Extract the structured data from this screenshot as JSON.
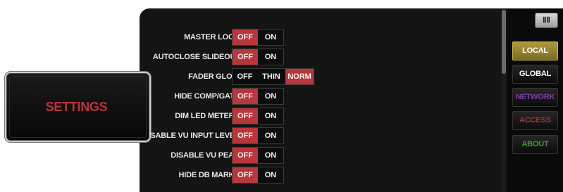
{
  "settings_tab": {
    "title": "SETTINGS"
  },
  "rows": [
    {
      "label": "MASTER LOCK:",
      "options": [
        "OFF",
        "ON"
      ],
      "selected": "OFF"
    },
    {
      "label": "AUTOCLOSE SLIDEOUT:",
      "options": [
        "OFF",
        "ON"
      ],
      "selected": "OFF"
    },
    {
      "label": "FADER GLOW:",
      "options": [
        "OFF",
        "THIN",
        "NORM"
      ],
      "selected": "NORM"
    },
    {
      "label": "HIDE COMP/GATE:",
      "options": [
        "OFF",
        "ON"
      ],
      "selected": "OFF"
    },
    {
      "label": "DIM LED METERS:",
      "options": [
        "OFF",
        "ON"
      ],
      "selected": "OFF"
    },
    {
      "label": "SABLE VU INPUT LEVEL:",
      "options": [
        "OFF",
        "ON"
      ],
      "selected": "OFF"
    },
    {
      "label": "DISABLE VU PEAK:",
      "options": [
        "OFF",
        "ON"
      ],
      "selected": "OFF"
    },
    {
      "label": "HIDE DB MARKS:",
      "options": [
        "OFF",
        "ON"
      ],
      "selected": "OFF"
    }
  ],
  "nav": {
    "menu_icon": "fader-icon",
    "items": [
      {
        "label": "LOCAL",
        "color": "#ffffff",
        "active": true
      },
      {
        "label": "GLOBAL",
        "color": "#ffffff",
        "active": false
      },
      {
        "label": "NETWORK",
        "color": "#7b3fa0",
        "active": false
      },
      {
        "label": "ACCESS",
        "color": "#a83236",
        "active": false
      },
      {
        "label": "ABOUT",
        "color": "#3f9a2e",
        "active": false
      }
    ]
  },
  "colors": {
    "active_toggle": "#b8363c",
    "nav_active": "#b09a3e",
    "settings_title": "#b8363c"
  },
  "scroll": {
    "position_fraction": 0.0
  }
}
